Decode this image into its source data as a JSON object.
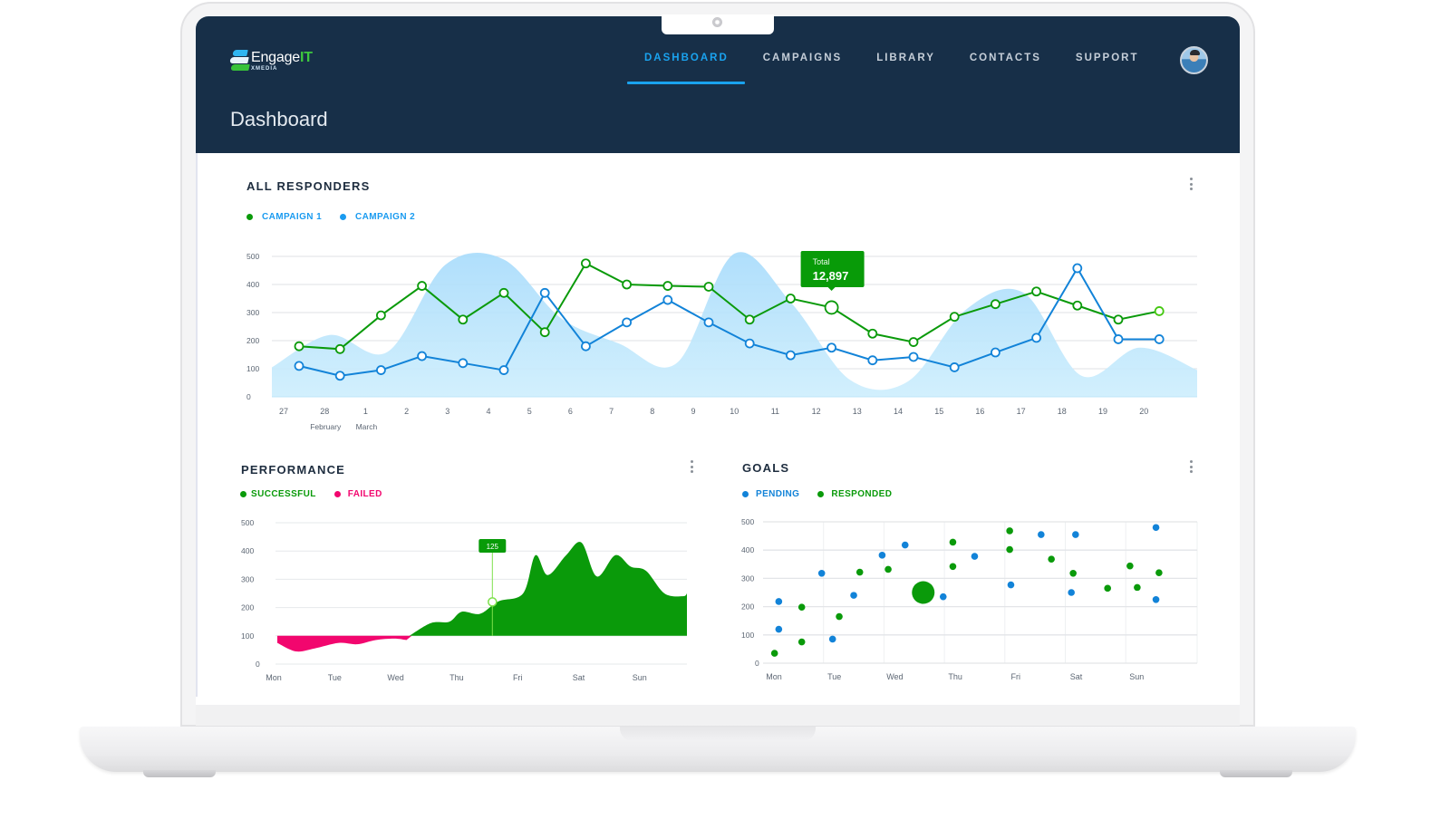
{
  "app": {
    "brand": "Engage",
    "brand_accent": "IT",
    "brand_sub": "XMEDIA",
    "page_title": "Dashboard"
  },
  "nav": {
    "items": [
      {
        "label": "DASHBOARD",
        "active": true
      },
      {
        "label": "CAMPAIGNS",
        "active": false
      },
      {
        "label": "LIBRARY",
        "active": false
      },
      {
        "label": "CONTACTS",
        "active": false
      },
      {
        "label": "SUPPORT",
        "active": false
      }
    ],
    "avatar": "user-avatar"
  },
  "colors": {
    "header_bg": "#172f48",
    "accent_blue": "#1aa3ef",
    "green": "#0a9a0a",
    "blue": "#1283d8",
    "pink": "#f2066e",
    "area": "#b3e0fb"
  },
  "cards": {
    "responders": {
      "title": "ALL RESPONDERS",
      "legend": [
        {
          "label": "CAMPAIGN 1",
          "color": "#0a9a0a"
        },
        {
          "label": "CAMPAIGN 2",
          "color": "#1a9bf0"
        }
      ],
      "tooltip": {
        "label": "Total",
        "value": "12,897"
      }
    },
    "performance": {
      "title": "PERFORMANCE",
      "legend": [
        {
          "label": "SUCCESSFUL",
          "color": "#0a9a0a"
        },
        {
          "label": "FAILED",
          "color": "#f2066e"
        }
      ],
      "tooltip": {
        "value": "125"
      }
    },
    "goals": {
      "title": "GOALS",
      "legend": [
        {
          "label": "PENDING",
          "color": "#1283d8"
        },
        {
          "label": "RESPONDED",
          "color": "#0a9a0a"
        }
      ]
    }
  },
  "chart_data": [
    {
      "id": "responders",
      "type": "line",
      "title": "ALL RESPONDERS",
      "ylim": [
        0,
        500
      ],
      "yticks": [
        0,
        100,
        200,
        300,
        400,
        500
      ],
      "categories": [
        "27",
        "28",
        "1",
        "2",
        "3",
        "4",
        "5",
        "6",
        "7",
        "8",
        "9",
        "10",
        "11",
        "12",
        "13",
        "14",
        "15",
        "16",
        "17",
        "18",
        "19",
        "20"
      ],
      "month_labels": [
        {
          "at": "28",
          "label": "February"
        },
        {
          "at": "1",
          "label": "March"
        }
      ],
      "grid": true,
      "series": [
        {
          "name": "CAMPAIGN 1",
          "color": "#0a9a0a",
          "values": [
            180,
            170,
            290,
            395,
            275,
            370,
            230,
            475,
            400,
            395,
            392,
            275,
            350,
            318,
            225,
            195,
            285,
            330,
            375,
            325,
            275,
            305
          ]
        },
        {
          "name": "CAMPAIGN 2",
          "color": "#1283d8",
          "values": [
            110,
            75,
            95,
            145,
            120,
            95,
            370,
            180,
            265,
            345,
            265,
            190,
            148,
            175,
            130,
            142,
            105,
            158,
            210,
            458,
            205,
            205
          ]
        }
      ],
      "background_area": {
        "name": "Total",
        "values": [
          105,
          220,
          160,
          470,
          490,
          280,
          190,
          120,
          510,
          330,
          60,
          55,
          310,
          370,
          75,
          175,
          95
        ]
      },
      "tooltip": {
        "at": "12",
        "label": "Total",
        "value": 12897
      }
    },
    {
      "id": "performance",
      "type": "area",
      "title": "PERFORMANCE",
      "ylim": [
        0,
        500
      ],
      "yticks": [
        0,
        100,
        200,
        300,
        400,
        500
      ],
      "categories": [
        "Mon",
        "Tue",
        "Wed",
        "Thu",
        "Fri",
        "Sat",
        "Sun"
      ],
      "baseline": 100,
      "series": [
        {
          "name": "FAILED",
          "color": "#f2066e",
          "x": [
            0,
            0.3,
            0.6,
            1.0,
            1.3,
            1.6,
            1.9,
            2.1
          ],
          "values": [
            75,
            45,
            55,
            75,
            70,
            85,
            90,
            85
          ]
        },
        {
          "name": "SUCCESSFUL",
          "color": "#0a9a0a",
          "x": [
            2.15,
            2.5,
            2.8,
            3.0,
            3.3,
            3.6,
            4.0,
            4.2,
            4.4,
            4.7,
            4.95,
            5.2,
            5.5,
            5.75,
            6.0,
            6.3,
            6.6,
            6.8
          ],
          "values": [
            100,
            145,
            150,
            185,
            178,
            222,
            250,
            385,
            315,
            385,
            430,
            310,
            385,
            345,
            330,
            250,
            240,
            250
          ]
        }
      ],
      "marker": {
        "x": 3.5,
        "value": 220,
        "label": "125"
      }
    },
    {
      "id": "goals",
      "type": "scatter",
      "title": "GOALS",
      "ylim": [
        0,
        500
      ],
      "yticks": [
        0,
        100,
        200,
        300,
        400,
        500
      ],
      "categories": [
        "Mon",
        "Tue",
        "Wed",
        "Thu",
        "Fri",
        "Sat",
        "Sun"
      ],
      "series": [
        {
          "name": "PENDING",
          "color": "#1283d8",
          "points": [
            [
              0.26,
              218
            ],
            [
              0.26,
              120
            ],
            [
              0.97,
              318
            ],
            [
              1.15,
              85
            ],
            [
              1.5,
              240
            ],
            [
              1.97,
              382
            ],
            [
              2.35,
              418
            ],
            [
              2.98,
              235
            ],
            [
              3.5,
              378
            ],
            [
              4.1,
              277
            ],
            [
              4.6,
              455
            ],
            [
              5.17,
              455
            ],
            [
              5.1,
              250
            ],
            [
              6.5,
              480
            ],
            [
              6.5,
              225
            ]
          ]
        },
        {
          "name": "RESPONDED",
          "color": "#0a9a0a",
          "points": [
            [
              0.19,
              35
            ],
            [
              0.64,
              75
            ],
            [
              0.64,
              198
            ],
            [
              1.26,
              165
            ],
            [
              1.6,
              322
            ],
            [
              2.07,
              332
            ],
            [
              3.14,
              428
            ],
            [
              3.14,
              342
            ],
            [
              4.08,
              468
            ],
            [
              4.08,
              402
            ],
            [
              4.77,
              368
            ],
            [
              5.13,
              318
            ],
            [
              5.7,
              265
            ],
            [
              6.07,
              344
            ],
            [
              6.19,
              268
            ],
            [
              6.55,
              320
            ]
          ]
        },
        {
          "name": "RESPONDED-highlight",
          "color": "#0a9a0a",
          "size": "large",
          "points": [
            [
              2.65,
              250
            ]
          ]
        }
      ]
    }
  ]
}
